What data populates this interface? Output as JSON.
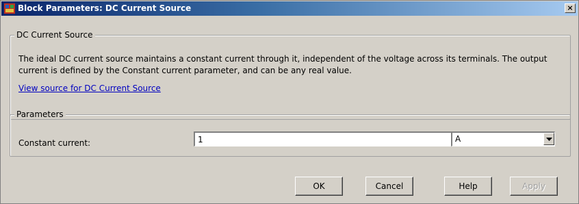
{
  "window": {
    "title": "Block Parameters: DC Current Source",
    "icon": "simulink-block-icon",
    "close_label": "×"
  },
  "description_group": {
    "legend": "DC Current Source",
    "text": "The ideal DC current source maintains a constant current through it, independent of the voltage across its terminals. The output current is defined by the Constant current parameter, and can be any real value.",
    "link_text": "View source for DC Current Source"
  },
  "parameters_group": {
    "legend": "Parameters",
    "constant_current_label": "Constant current:",
    "constant_current_value": "1",
    "unit_value": "A"
  },
  "buttons": {
    "ok": "OK",
    "cancel": "Cancel",
    "help": "Help",
    "apply": "Apply"
  },
  "colors": {
    "titlebar_start": "#0a246a",
    "titlebar_end": "#a6caf0",
    "dialog_background": "#d4d0c8",
    "link": "#0000c0",
    "disabled_text": "#a0a0a0"
  }
}
